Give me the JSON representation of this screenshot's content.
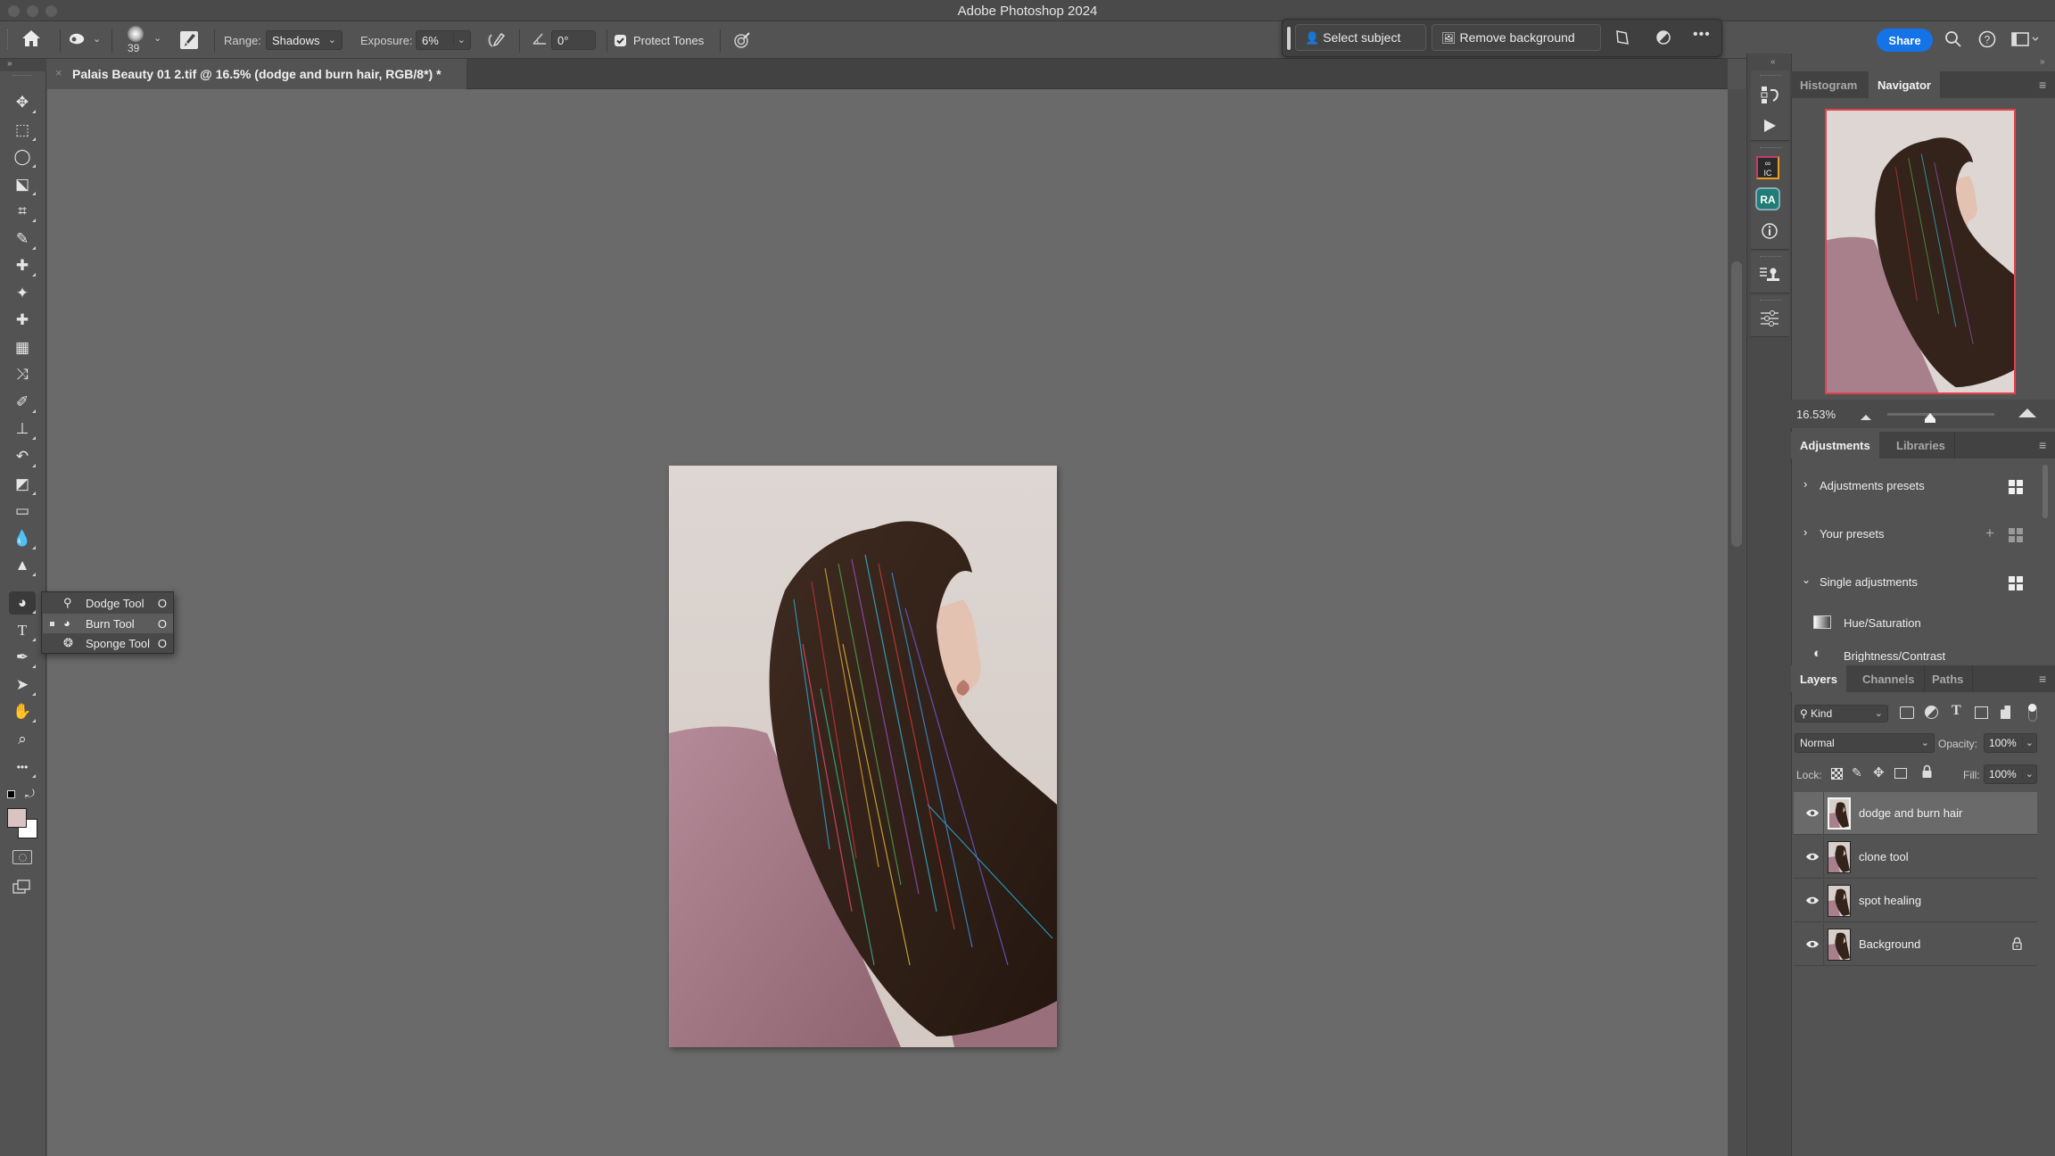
{
  "window": {
    "title": "Adobe Photoshop 2024"
  },
  "options_bar": {
    "brush_size": "39",
    "range_label": "Range:",
    "range_value": "Shadows",
    "exposure_label": "Exposure:",
    "exposure_value": "6%",
    "angle_value": "0°",
    "protect_tones_label": "Protect Tones",
    "protect_tones_checked": true
  },
  "contextual_taskbar": {
    "select_subject_label": "Select subject",
    "remove_background_label": "Remove background"
  },
  "header_right": {
    "share_label": "Share"
  },
  "document_tab": {
    "close_glyph": "×",
    "title": "Palais Beauty 01 2.tif @ 16.5% (dodge and burn hair, RGB/8*) *"
  },
  "toolbar": {
    "collapse_glyph": "»",
    "tools": [
      {
        "name": "move-tool",
        "glyph": "✥"
      },
      {
        "name": "rectangular-marquee-tool",
        "glyph": "⬚"
      },
      {
        "name": "lasso-tool",
        "glyph": "◯"
      },
      {
        "name": "object-selection-tool",
        "glyph": "⬕"
      },
      {
        "name": "crop-tool",
        "glyph": "⌗"
      },
      {
        "name": "eyedropper-tool",
        "glyph": "✎"
      },
      {
        "name": "spot-healing-brush-tool",
        "glyph": "✚"
      },
      {
        "name": "remove-tool",
        "glyph": "✦"
      },
      {
        "name": "healing-brush-tool",
        "glyph": "✚"
      },
      {
        "name": "patch-tool",
        "glyph": "▦"
      },
      {
        "name": "content-aware-move-tool",
        "glyph": "⤨"
      },
      {
        "name": "brush-tool",
        "glyph": "✐"
      },
      {
        "name": "clone-stamp-tool",
        "glyph": "⊥"
      },
      {
        "name": "history-brush-tool",
        "glyph": "↶"
      },
      {
        "name": "eraser-tool",
        "glyph": "◩"
      },
      {
        "name": "gradient-tool",
        "glyph": "▭"
      },
      {
        "name": "blur-tool",
        "glyph": "💧"
      },
      {
        "name": "sharpen-tool",
        "glyph": "▲"
      },
      {
        "name": "burn-tool",
        "glyph": "◕"
      },
      {
        "name": "type-tool",
        "glyph": "T"
      },
      {
        "name": "pen-tool",
        "glyph": "✒"
      },
      {
        "name": "path-selection-tool",
        "glyph": "➤"
      },
      {
        "name": "hand-tool",
        "glyph": "✋"
      },
      {
        "name": "zoom-tool",
        "glyph": "⌕"
      },
      {
        "name": "edit-toolbar",
        "glyph": "•••"
      }
    ],
    "foreground_color": "#d9c3c3",
    "background_color": "#ffffff"
  },
  "tool_flyout": {
    "items": [
      {
        "label": "Dodge Tool",
        "shortcut": "O",
        "selected": false,
        "glyph": "⚲"
      },
      {
        "label": "Burn Tool",
        "shortcut": "O",
        "selected": true,
        "glyph": "◕"
      },
      {
        "label": "Sponge Tool",
        "shortcut": "O",
        "selected": false,
        "glyph": "❂"
      }
    ]
  },
  "navigator_panel": {
    "tabs": [
      {
        "label": "Histogram",
        "active": false
      },
      {
        "label": "Navigator",
        "active": true
      }
    ],
    "zoom_value": "16.53%",
    "zoom_slider_fraction": 0.4
  },
  "adjustments_panel": {
    "tabs": [
      {
        "label": "Adjustments",
        "active": true
      },
      {
        "label": "Libraries",
        "active": false
      }
    ],
    "sections": [
      {
        "label": "Adjustments presets",
        "expanded": false
      },
      {
        "label": "Your presets",
        "expanded": false
      },
      {
        "label": "Single adjustments",
        "expanded": true
      }
    ],
    "items": [
      {
        "label": "Hue/Saturation"
      },
      {
        "label": "Brightness/Contrast"
      }
    ]
  },
  "layers_panel": {
    "tabs": [
      {
        "label": "Layers",
        "active": true
      },
      {
        "label": "Channels",
        "active": false
      },
      {
        "label": "Paths",
        "active": false
      }
    ],
    "filter_kind": "Kind",
    "blend_mode": "Normal",
    "opacity_label": "Opacity:",
    "opacity_value": "100%",
    "lock_label": "Lock:",
    "fill_label": "Fill:",
    "fill_value": "100%",
    "layers": [
      {
        "name": "dodge and burn hair",
        "visible": true,
        "selected": true,
        "locked": false
      },
      {
        "name": "clone tool",
        "visible": true,
        "selected": false,
        "locked": false
      },
      {
        "name": "spot healing",
        "visible": true,
        "selected": false,
        "locked": false
      },
      {
        "name": "Background",
        "visible": true,
        "selected": false,
        "locked": true
      }
    ]
  },
  "colors": {
    "accent_blue": "#1473e6",
    "navigator_frame": "#e2414b",
    "ra_badge": "#1f7d75"
  }
}
